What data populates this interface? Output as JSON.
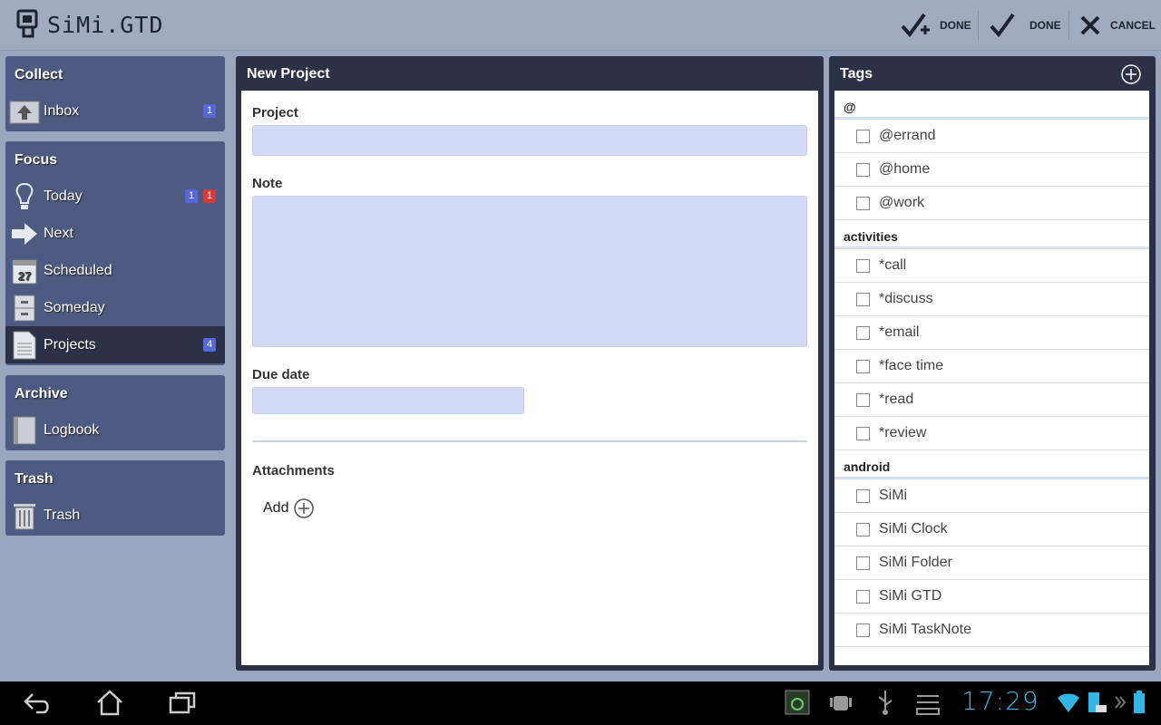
{
  "app": {
    "title": "SiMi.GTD"
  },
  "actions": {
    "done_plus_label": "DONE",
    "done_label": "DONE",
    "cancel_label": "CANCEL"
  },
  "sidebar": {
    "collect": {
      "title": "Collect",
      "items": [
        {
          "label": "Inbox",
          "badge_blue": "1"
        }
      ]
    },
    "focus": {
      "title": "Focus",
      "items": [
        {
          "label": "Today",
          "badge_blue": "1",
          "badge_red": "1"
        },
        {
          "label": "Next"
        },
        {
          "label": "Scheduled",
          "calendar_day": "27"
        },
        {
          "label": "Someday"
        },
        {
          "label": "Projects",
          "badge_blue": "4",
          "active": true
        }
      ]
    },
    "archive": {
      "title": "Archive",
      "items": [
        {
          "label": "Logbook"
        }
      ]
    },
    "trash": {
      "title": "Trash",
      "items": [
        {
          "label": "Trash"
        }
      ]
    }
  },
  "form": {
    "title": "New Project",
    "project_label": "Project",
    "project_value": "",
    "note_label": "Note",
    "note_value": "",
    "due_label": "Due date",
    "due_value": "",
    "attachments_label": "Attachments",
    "add_label": "Add"
  },
  "tags": {
    "title": "Tags",
    "groups": [
      {
        "name": "@",
        "items": [
          "@errand",
          "@home",
          "@work"
        ]
      },
      {
        "name": "activities",
        "items": [
          "*call",
          "*discuss",
          "*email",
          "*face time",
          "*read",
          "*review"
        ]
      },
      {
        "name": "android",
        "items": [
          "SiMi",
          "SiMi Clock",
          "SiMi Folder",
          "SiMi GTD",
          "SiMi TaskNote"
        ]
      }
    ]
  },
  "statusbar": {
    "time": "17:29"
  },
  "colors": {
    "accent": "#33b5e5",
    "panel": "#4d5a82",
    "panel_dark": "#2b3147",
    "field": "#d3daf3",
    "badge_blue": "#5868d8",
    "badge_red": "#d43c3c"
  }
}
